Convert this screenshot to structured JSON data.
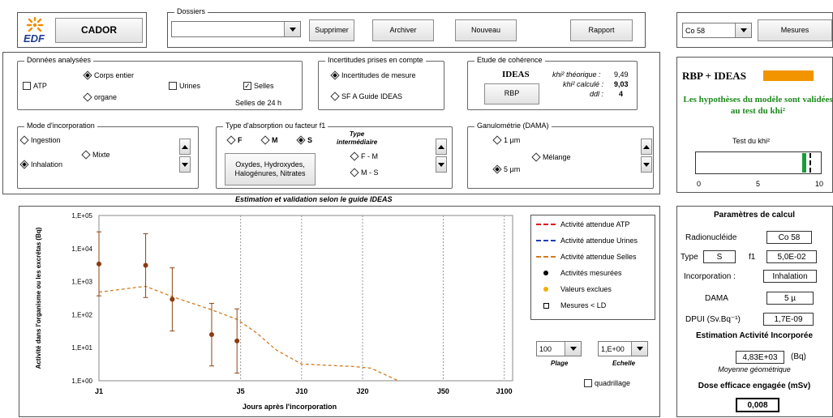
{
  "app": {
    "name": "CADOR",
    "logo_text": "EDF"
  },
  "toolbar": {
    "dossiers_label": "Dossiers",
    "dossiers_value": "",
    "supprimer": "Supprimer",
    "archiver": "Archiver",
    "nouveau": "Nouveau",
    "rapport": "Rapport",
    "radionuclide_select": "Co 58",
    "mesures": "Mesures"
  },
  "donnees": {
    "title": "Données analysées",
    "corps_entier": "Corps entier",
    "organe": "organe",
    "atp": "ATP",
    "urines": "Urines",
    "selles": "Selles",
    "selles_note": "Selles de 24 h"
  },
  "incertitudes": {
    "title": "Incertitudes prises en compte",
    "mesure": "Incertitudes de mesure",
    "sfa": "SF A  Guide IDEAS"
  },
  "coherence": {
    "title": "Etude  de  cohérence",
    "ideas": "IDEAS",
    "rbp_btn": "RBP",
    "khi_theo_label": "khi² théorique :",
    "khi_theo": "9,49",
    "khi_calc_label": "khi² calculé :",
    "khi_calc": "9,03",
    "ddl_label": "ddl :",
    "ddl": "4"
  },
  "rbp": {
    "title": "RBP + IDEAS",
    "bar_color": "#f29400",
    "message": "Les hypothèses du modèle sont validées au test du khi²",
    "test_label": "Test du khi²",
    "ticks": [
      "0",
      "5",
      "10"
    ],
    "khi_value": 9.03,
    "khi_threshold": 9.49,
    "max": 10
  },
  "incorporation": {
    "title": "Mode d'incorporation",
    "ingestion": "Ingestion",
    "mixte": "Mixte",
    "inhalation": "Inhalation"
  },
  "absorption": {
    "title": "Type d'absorption  ou facteur f1",
    "f": "F",
    "m": "M",
    "s": "S",
    "intermediate_title": "Type intermédiaire",
    "fm": "F - M",
    "ms": "M - S",
    "compounds": "Oxydes, Hydroxydes, Halogénures, Nitrates"
  },
  "granulometrie": {
    "title": "Ganulométrie  (DAMA)",
    "um1": "1 µm",
    "melange": "Mélange",
    "um5": "5 µm"
  },
  "chart_title": "Estimation et validation selon le guide  IDEAS",
  "chart_data": {
    "type": "scatter",
    "xlabel": "Jours après l'incorporation",
    "ylabel": "Activité dans l'organisme ou les excrétas (Bq)",
    "y_ticks": [
      "1,E+05",
      "1,E+04",
      "1,E+03",
      "1,E+02",
      "1,E+01",
      "1,E+00"
    ],
    "y_log_range": [
      0,
      5
    ],
    "x_ticks": [
      "J1",
      "J5",
      "J10",
      "J20",
      "J50",
      "J100"
    ],
    "x_range": [
      1,
      110
    ],
    "series": [
      {
        "name": "Activité mesurées",
        "x": [
          1,
          1.7,
          2.3,
          3.6,
          4.8
        ],
        "y": [
          3400,
          3100,
          290,
          25,
          16
        ],
        "err_hi": [
          32000,
          28000,
          2600,
          220,
          150
        ],
        "err_lo": [
          370,
          330,
          32,
          2.8,
          1.7
        ]
      },
      {
        "name": "Activité attendue Selles",
        "x": [
          1,
          1.7,
          2.3,
          3.6,
          4.8,
          6,
          7.5,
          10,
          14,
          18,
          22,
          26,
          30
        ],
        "y": [
          480,
          720,
          350,
          140,
          72,
          28,
          8.5,
          3.2,
          2.9,
          2.7,
          2.4,
          1.5,
          1.0
        ]
      }
    ]
  },
  "legend": [
    {
      "label": "Activité attendue ATP",
      "color": "#e0001a",
      "kind": "dash"
    },
    {
      "label": "Activité attendue Urines",
      "color": "#1f3fae",
      "kind": "dash"
    },
    {
      "label": "Activité attendue Selles",
      "color": "#d27a22",
      "kind": "dash"
    },
    {
      "label": "Activités mesurées",
      "color": "#000000",
      "kind": "dot"
    },
    {
      "label": "Valeurs exclues",
      "color": "#f2b100",
      "kind": "dot"
    },
    {
      "label": "Mesures < LD",
      "color": "#000000",
      "kind": "square"
    }
  ],
  "plage": {
    "value": "100",
    "label": "Plage"
  },
  "echelle": {
    "value": "1,E+00",
    "label": "Echelle"
  },
  "quadrillage": "quadrillage",
  "params": {
    "title": "Paramètres de calcul",
    "radionucleide_label": "Radionucléide",
    "radionucleide": "Co 58",
    "type_label": "Type",
    "type": "S",
    "f1_label": "f1",
    "f1": "5,0E-02",
    "incorporation_label": "Incorporation :",
    "incorporation": "Inhalation",
    "dama_label": "DAMA",
    "dama": "5 µ",
    "dpui_label": "DPUI (Sv.Bq⁻¹)",
    "dpui": "1,7E-09",
    "estimation_title": "Estimation Activité Incorporée",
    "activite": "4,83E+03",
    "activite_unit": "(Bq)",
    "moyenne": "Moyenne géométrique",
    "dose_title": "Dose efficace engagée (mSv)",
    "dose": "0,008"
  }
}
